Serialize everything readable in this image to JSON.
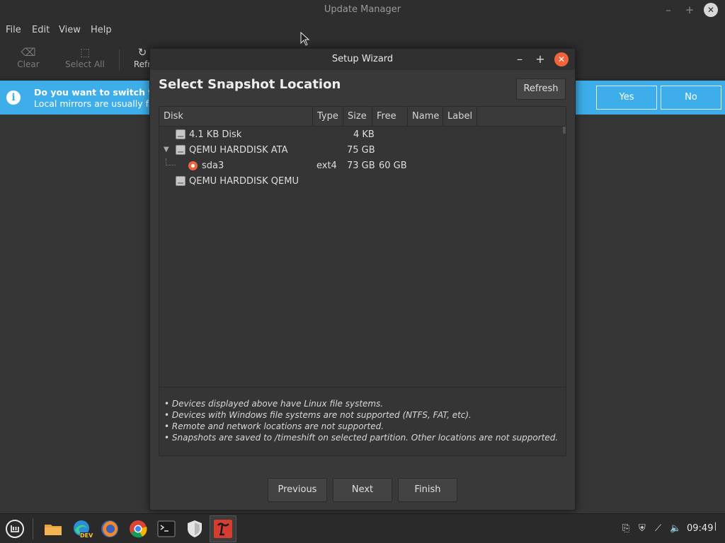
{
  "background_window": {
    "title": "Update Manager",
    "menu": [
      "File",
      "Edit",
      "View",
      "Help"
    ],
    "toolbar": {
      "clear_label": "Clear",
      "select_all_label": "Select All",
      "refresh_label": "Refr"
    },
    "infobar": {
      "line1": "Do you want to switch to a",
      "line2": "Local mirrors are usually fa",
      "yes_label": "Yes",
      "no_label": "No"
    }
  },
  "dialog": {
    "title": "Setup Wizard",
    "heading": "Select Snapshot Location",
    "refresh_label": "Refresh",
    "columns": [
      "Disk",
      "Type",
      "Size",
      "Free",
      "Name",
      "Label"
    ],
    "rows": [
      {
        "disk": "4.1 KB Disk",
        "type": "",
        "size": "4 KB",
        "free": "",
        "name": "",
        "label": ""
      },
      {
        "disk": "QEMU HARDDISK ATA",
        "type": "",
        "size": "75 GB",
        "free": "",
        "name": "",
        "label": ""
      },
      {
        "disk": "sda3",
        "type": "ext4",
        "size": "73 GB",
        "free": "60 GB",
        "name": "",
        "label": ""
      },
      {
        "disk": "QEMU HARDDISK QEMU",
        "type": "",
        "size": "",
        "free": "",
        "name": "",
        "label": ""
      }
    ],
    "notes": [
      "• Devices displayed above have Linux file systems.",
      "• Devices with Windows file systems are not supported (NTFS, FAT, etc).",
      "• Remote and network locations are not supported.",
      "• Snapshots are saved to /timeshift on selected partition. Other locations are not supported."
    ],
    "buttons": {
      "previous": "Previous",
      "next": "Next",
      "finish": "Finish"
    }
  },
  "taskbar": {
    "clock": "09:49",
    "firefox_badge": "DEV"
  },
  "colors": {
    "accent": "#3daee9",
    "close_orange": "#f0643c"
  }
}
